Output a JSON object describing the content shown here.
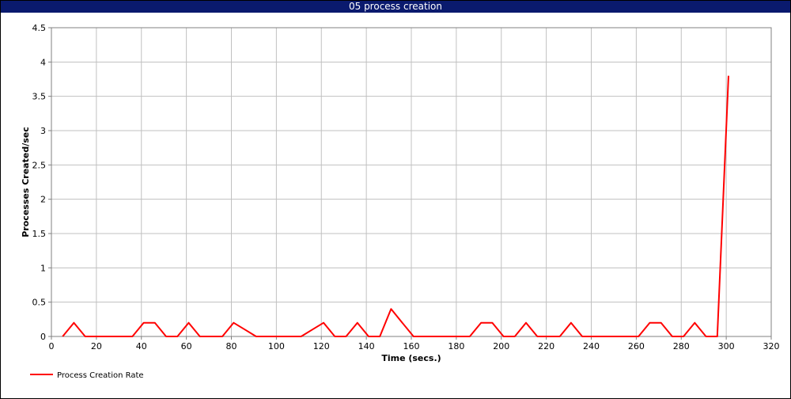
{
  "window": {
    "title": "05 process creation"
  },
  "colors": {
    "titlebar": "#0a1a6e",
    "series": "#ff0000",
    "grid": "#c0c0c0"
  },
  "chart_data": {
    "type": "line",
    "title": "05 process creation",
    "xlabel": "Time (secs.)",
    "ylabel": "Processes Created/sec",
    "xlim": [
      0,
      320
    ],
    "ylim": [
      0,
      4.5
    ],
    "xticks": [
      0,
      20,
      40,
      60,
      80,
      100,
      120,
      140,
      160,
      180,
      200,
      220,
      240,
      260,
      280,
      300,
      320
    ],
    "yticks": [
      0,
      0.5,
      1,
      1.5,
      2,
      2.5,
      3,
      3.5,
      4,
      4.5
    ],
    "ytick_labels": [
      "0",
      "0.5",
      "1",
      "1.5",
      "2",
      "2.5",
      "3",
      "3.5",
      "4",
      "4.5"
    ],
    "grid": true,
    "legend": "bottom-left",
    "series": [
      {
        "name": "Process Creation Rate",
        "color": "#ff0000",
        "x": [
          5,
          10,
          15,
          20,
          25,
          30,
          36,
          41,
          46,
          51,
          56,
          61,
          66,
          71,
          76,
          81,
          86,
          91,
          96,
          101,
          106,
          111,
          116,
          121,
          126,
          131,
          136,
          141,
          146,
          151,
          156,
          161,
          166,
          171,
          176,
          181,
          186,
          191,
          196,
          201,
          206,
          211,
          216,
          221,
          226,
          231,
          236,
          241,
          246,
          251,
          256,
          261,
          266,
          271,
          276,
          281,
          286,
          291,
          296,
          301
        ],
        "y": [
          0,
          0.2,
          0,
          0,
          0,
          0,
          0,
          0.2,
          0.2,
          0,
          0,
          0.2,
          0,
          0,
          0,
          0.2,
          0.1,
          0,
          0,
          0,
          0,
          0,
          0.1,
          0.2,
          0,
          0,
          0.2,
          0,
          0,
          0.4,
          0.2,
          0,
          0,
          0,
          0,
          0,
          0,
          0.2,
          0.2,
          0,
          0,
          0.2,
          0,
          0,
          0,
          0.2,
          0,
          0,
          0,
          0,
          0,
          0,
          0.2,
          0.2,
          0,
          0,
          0.2,
          0,
          0,
          3.8
        ]
      }
    ]
  }
}
